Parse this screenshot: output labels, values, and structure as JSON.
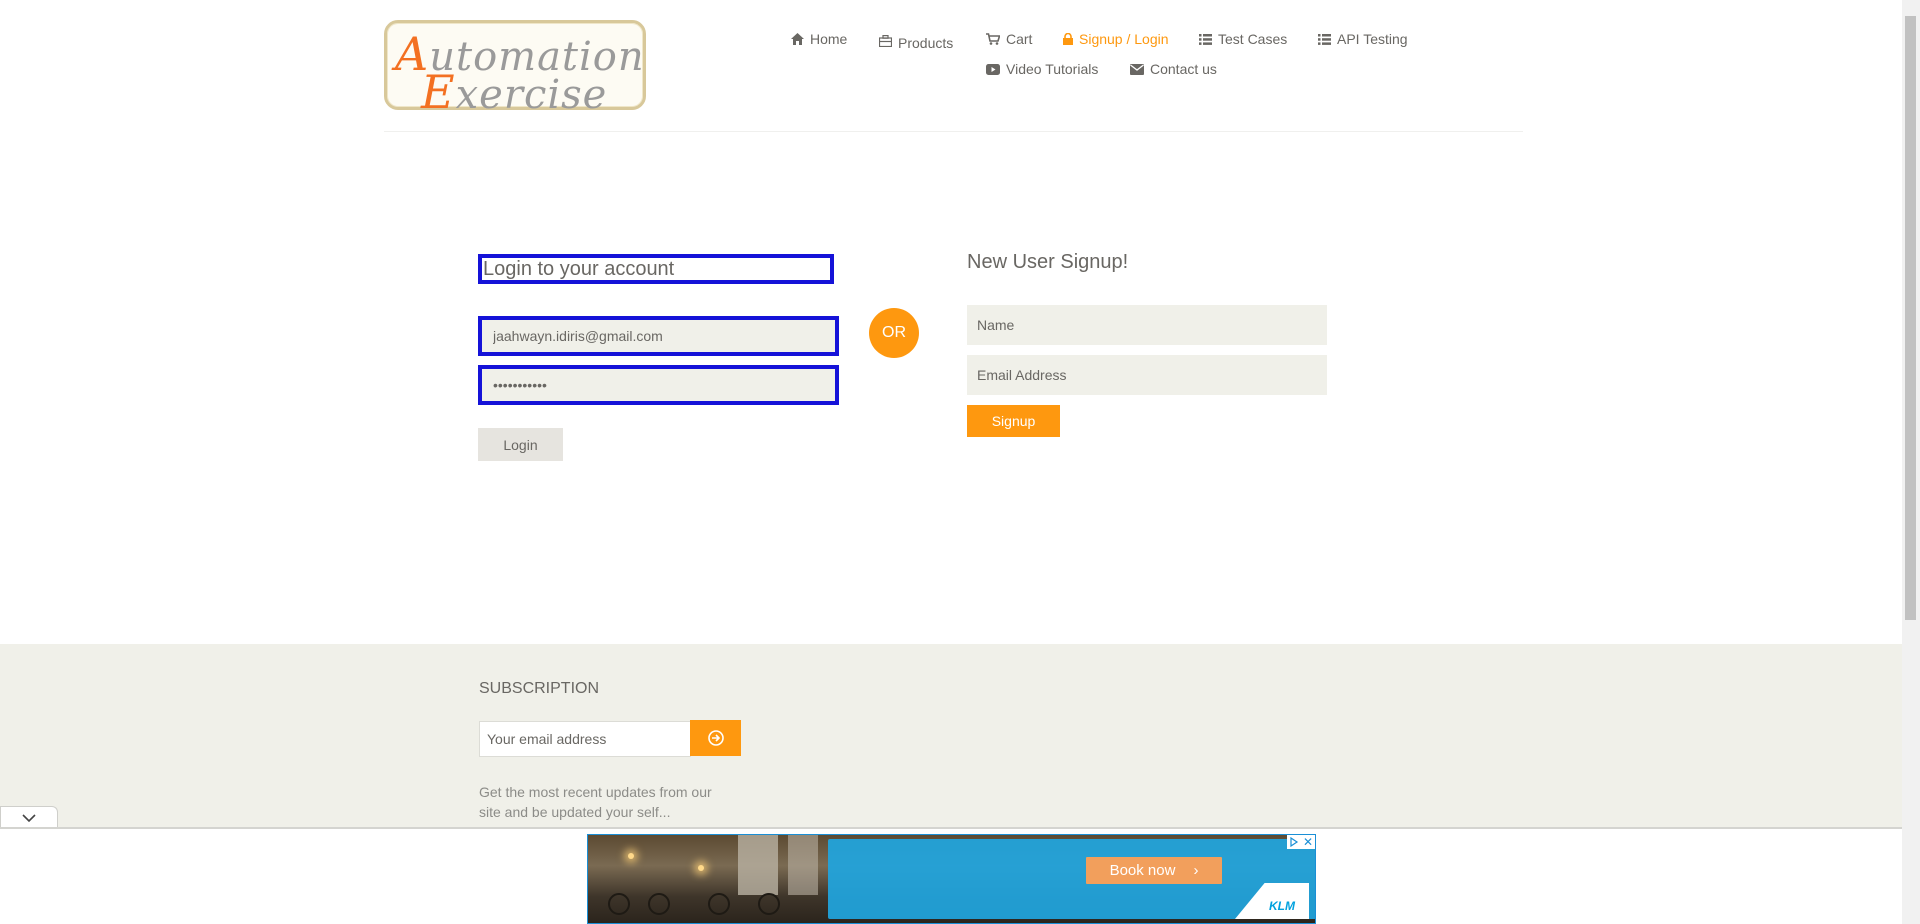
{
  "logo": {
    "line1_cap": "A",
    "line1_rest": "utomation",
    "line2_cap": "E",
    "line2_rest": "xercise"
  },
  "nav": {
    "items": [
      {
        "label": "Home",
        "icon": "home-icon"
      },
      {
        "label": "Products",
        "icon": "briefcase-icon"
      },
      {
        "label": "Cart",
        "icon": "cart-icon"
      },
      {
        "label": "Signup / Login",
        "icon": "lock-icon",
        "active": true
      },
      {
        "label": "Test Cases",
        "icon": "list-icon"
      },
      {
        "label": "API Testing",
        "icon": "list-icon"
      },
      {
        "label": "Video Tutorials",
        "icon": "youtube-icon"
      },
      {
        "label": "Contact us",
        "icon": "envelope-icon"
      }
    ]
  },
  "login": {
    "title": "Login to your account",
    "email_value": "jaahwayn.idiris@gmail.com",
    "password_value": "•••••••••••",
    "button": "Login"
  },
  "or_label": "OR",
  "signup": {
    "title": "New User Signup!",
    "name_placeholder": "Name",
    "email_placeholder": "Email Address",
    "button": "Signup"
  },
  "footer": {
    "title": "SUBSCRIPTION",
    "email_placeholder": "Your email address",
    "text": "Get the most recent updates from our site and be updated your self..."
  },
  "ad": {
    "cta": "Book now",
    "brand": "KLM"
  },
  "colors": {
    "accent": "#FE980F",
    "highlight": "#1512D8",
    "field_bg": "#F0F0E9",
    "text": "#696763"
  }
}
